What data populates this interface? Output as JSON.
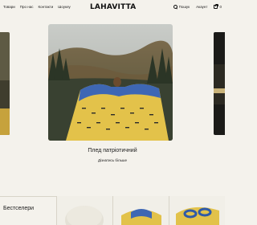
{
  "header": {
    "nav": [
      "Товари",
      "Про нас",
      "Контакти",
      "Шоукеу"
    ],
    "logo": "LAHAVITTA",
    "search_label": "Пошук",
    "account_label": "Акаунт",
    "cart_count": "0"
  },
  "hero": {
    "title": "Плед патріотичний",
    "link": "Дізнатись більше"
  },
  "bestsellers": {
    "title": "Бестселери"
  }
}
